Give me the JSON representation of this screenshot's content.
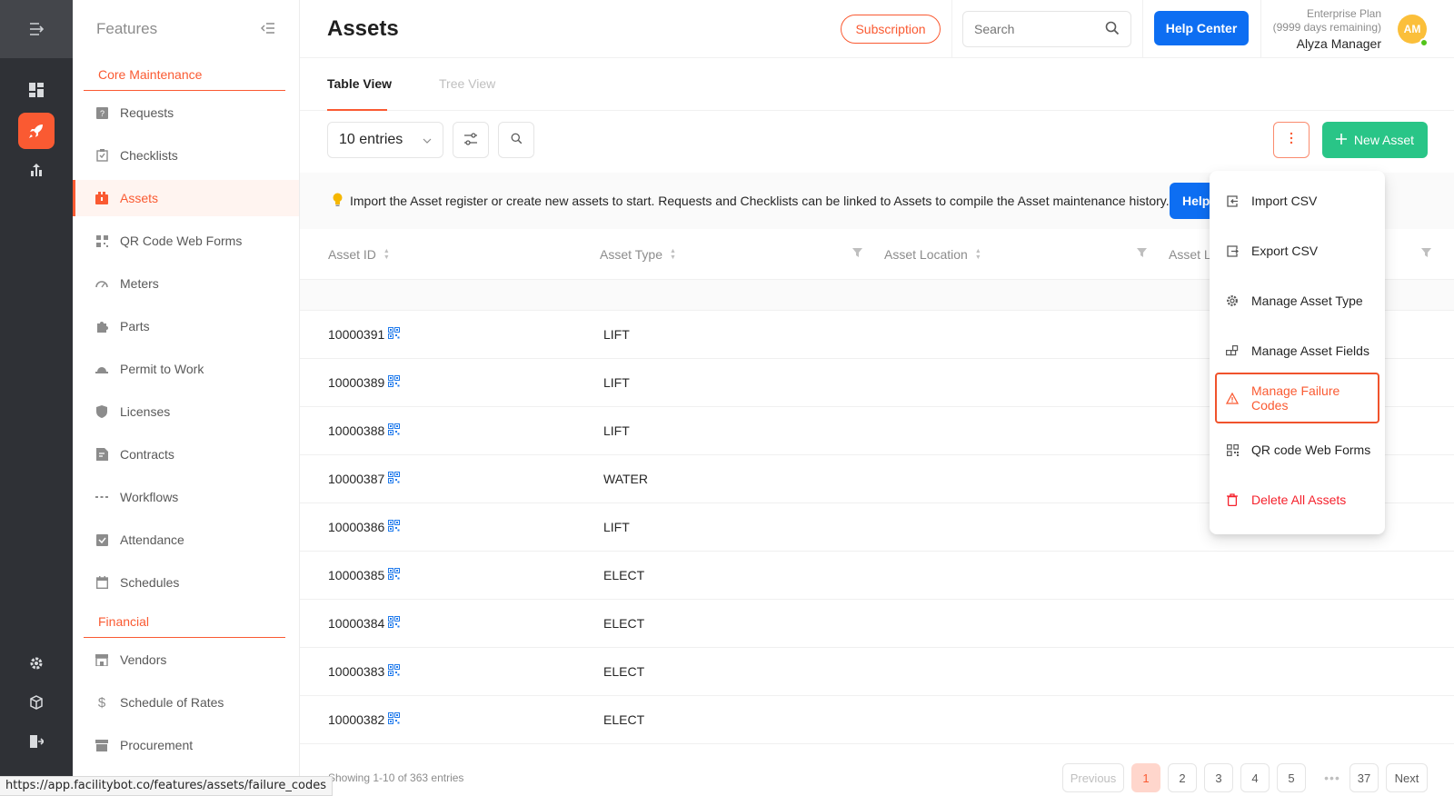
{
  "sidebar": {
    "title": "Features",
    "section_core": "Core Maintenance",
    "section_financial": "Financial",
    "items": [
      {
        "label": "Requests"
      },
      {
        "label": "Checklists"
      },
      {
        "label": "Assets"
      },
      {
        "label": "QR Code Web Forms"
      },
      {
        "label": "Meters"
      },
      {
        "label": "Parts"
      },
      {
        "label": "Permit to Work"
      },
      {
        "label": "Licenses"
      },
      {
        "label": "Contracts"
      },
      {
        "label": "Workflows"
      },
      {
        "label": "Attendance"
      },
      {
        "label": "Schedules"
      },
      {
        "label": "Vendors"
      },
      {
        "label": "Schedule of Rates"
      },
      {
        "label": "Procurement"
      }
    ]
  },
  "header": {
    "title": "Assets",
    "subscription": "Subscription",
    "search_placeholder": "Search",
    "help_center": "Help Center",
    "plan": "Enterprise Plan",
    "days_remaining": "(9999 days remaining)",
    "user_name": "Alyza Manager",
    "avatar_initials": "AM"
  },
  "tabs": {
    "table_view": "Table View",
    "tree_view": "Tree View"
  },
  "toolbar": {
    "entries": "10 entries",
    "new_asset": "New Asset"
  },
  "notice": {
    "text": "Import the Asset register or create new assets to start. Requests and Checklists can be linked to Assets to compile the Asset maintenance history.",
    "help": "Help"
  },
  "table": {
    "columns": [
      "Asset ID",
      "Asset Type",
      "Asset Location",
      "Asset L"
    ],
    "rows": [
      {
        "id": "10000391",
        "type": "LIFT"
      },
      {
        "id": "10000389",
        "type": "LIFT"
      },
      {
        "id": "10000388",
        "type": "LIFT"
      },
      {
        "id": "10000387",
        "type": "WATER"
      },
      {
        "id": "10000386",
        "type": "LIFT"
      },
      {
        "id": "10000385",
        "type": "ELECT"
      },
      {
        "id": "10000384",
        "type": "ELECT"
      },
      {
        "id": "10000383",
        "type": "ELECT"
      },
      {
        "id": "10000382",
        "type": "ELECT"
      }
    ]
  },
  "footer": {
    "showing": "Showing 1-10 of 363 entries",
    "previous": "Previous",
    "next": "Next",
    "pages": [
      "1",
      "2",
      "3",
      "4",
      "5",
      "37"
    ],
    "ellipsis": "•••"
  },
  "menu": {
    "items": [
      {
        "label": "Import CSV",
        "icon": "import-icon"
      },
      {
        "label": "Export CSV",
        "icon": "export-icon"
      },
      {
        "label": "Manage Asset Type",
        "icon": "gear-icon"
      },
      {
        "label": "Manage Asset Fields",
        "icon": "fields-icon"
      },
      {
        "label": "Manage Failure Codes",
        "icon": "warning-icon"
      },
      {
        "label": "QR code Web Forms",
        "icon": "qr-icon"
      },
      {
        "label": "Delete All Assets",
        "icon": "trash-icon"
      }
    ]
  },
  "status_url": "https://app.facilitybot.co/features/assets/failure_codes",
  "colors": {
    "accent": "#fa5a32",
    "primary": "#0d6ef2",
    "success": "#29c587",
    "danger": "#f5222d"
  }
}
